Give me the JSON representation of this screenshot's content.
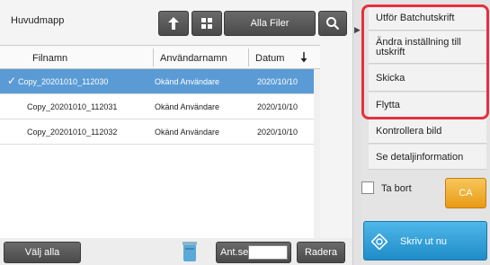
{
  "toolbar": {
    "folder_title": "Huvudmapp",
    "up_icon": "arrow-up-icon",
    "grid_icon": "grid-view-icon",
    "all_files_label": "Alla Filer",
    "search_icon": "search-icon"
  },
  "table": {
    "columns": [
      "Filnamn",
      "Användarnamn",
      "Datum"
    ],
    "sort_icon": "sort-descending-icon",
    "rows": [
      {
        "filename": "Copy_20201010_112030",
        "user": "Okänd Användare",
        "date": "2020/10/10",
        "selected": true
      },
      {
        "filename": "Copy_20201010_112031",
        "user": "Okänd Användare",
        "date": "2020/10/10",
        "selected": false
      },
      {
        "filename": "Copy_20201010_112032",
        "user": "Okänd Användare",
        "date": "2020/10/10",
        "selected": false
      }
    ]
  },
  "bottom": {
    "select_all_label": "Välj alla",
    "copies_label": "Ant.set",
    "copies_value": "",
    "delete_label": "Radera"
  },
  "side_panel": {
    "items": [
      "Utför Batchutskrift",
      "Ändra inställning till utskrift",
      "Skicka",
      "Flytta",
      "Kontrollera bild",
      "Se detaljinformation"
    ],
    "delete_checkbox_label": "Ta bort",
    "ca_label": "CA",
    "print_label": "Skriv ut nu"
  },
  "colors": {
    "selected_row": "#5b9bd5",
    "highlight": "#e5303e",
    "print_button": "#1f8cc9",
    "ca_button": "#e89a16"
  }
}
